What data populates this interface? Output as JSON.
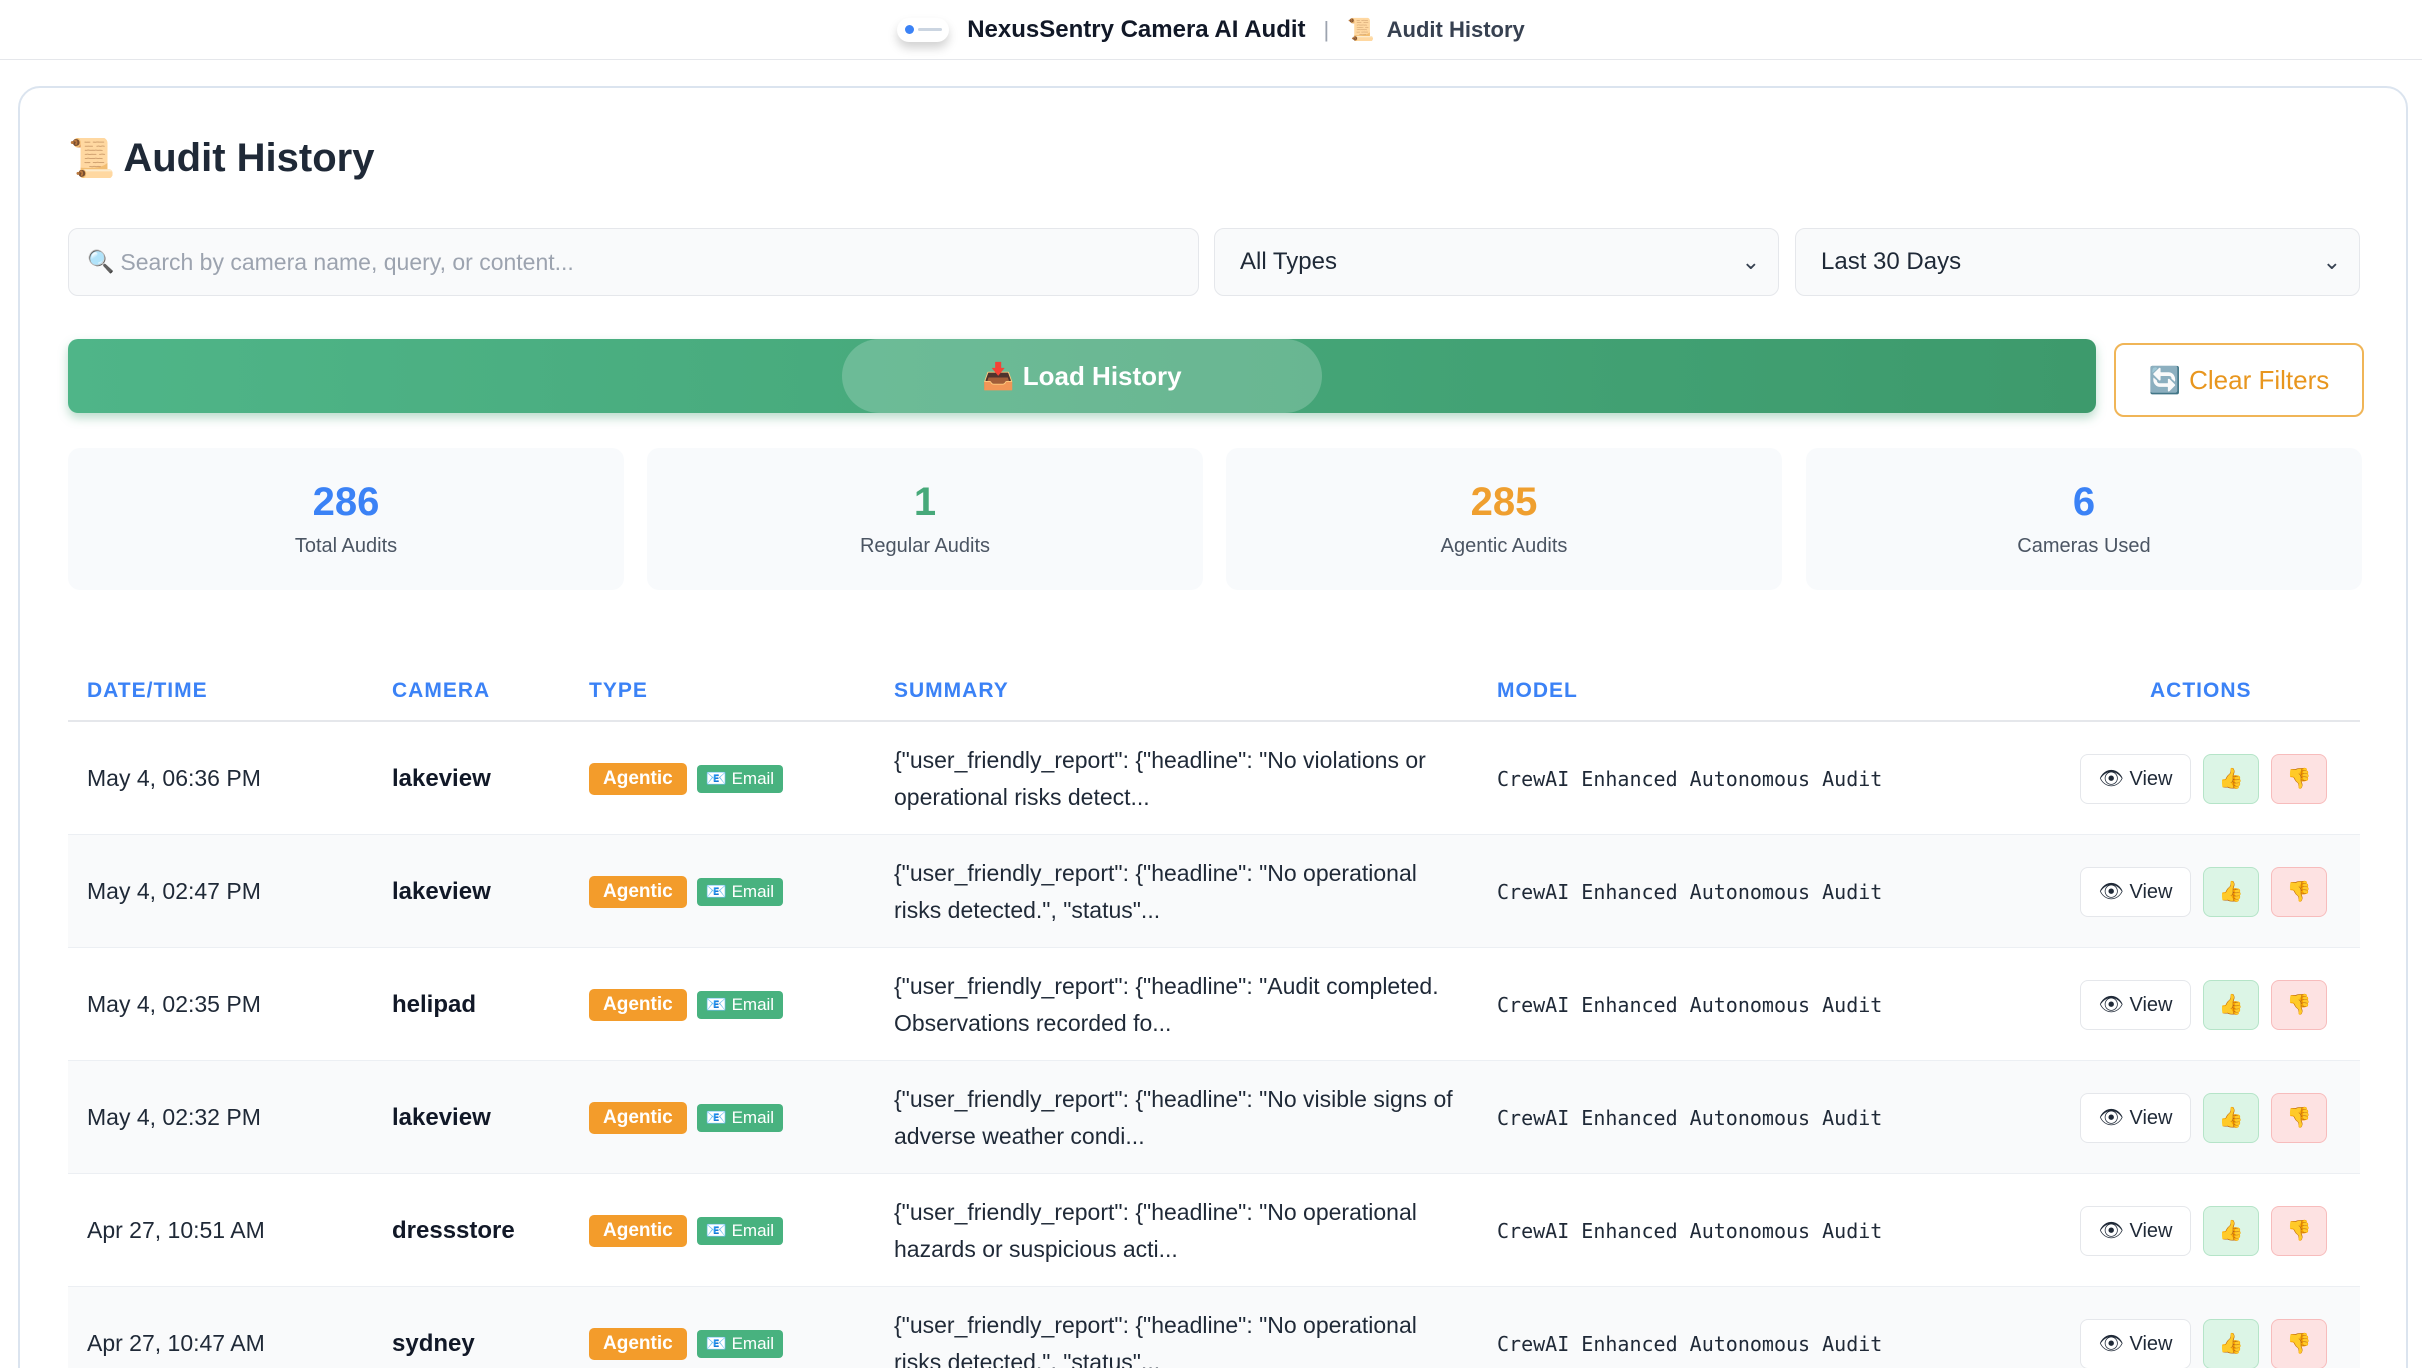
{
  "header": {
    "app_title": "NexusSentry Camera AI Audit",
    "separator": "|",
    "breadcrumb_icon": "📜",
    "breadcrumb": "Audit History"
  },
  "page": {
    "title_icon": "📜",
    "title": "Audit History"
  },
  "filters": {
    "search_icon": "🔍",
    "search_placeholder": "Search by camera name, query, or content...",
    "type_selected": "All Types",
    "range_selected": "Last 30 Days"
  },
  "buttons": {
    "load_icon": "📥",
    "load_label": "Load History",
    "clear_icon": "🔄",
    "clear_label": "Clear Filters"
  },
  "stats": [
    {
      "value": "286",
      "label": "Total Audits"
    },
    {
      "value": "1",
      "label": "Regular Audits"
    },
    {
      "value": "285",
      "label": "Agentic Audits"
    },
    {
      "value": "6",
      "label": "Cameras Used"
    }
  ],
  "table": {
    "headers": [
      "DATE/TIME",
      "CAMERA",
      "TYPE",
      "SUMMARY",
      "MODEL",
      "ACTIONS"
    ],
    "rows": [
      {
        "date": "May 4, 06:36 PM",
        "camera": "lakeview",
        "type": "Agentic",
        "channel": "📧 Email",
        "summary": "{\"user_friendly_report\": {\"headline\": \"No violations or operational risks detect...",
        "model": "CrewAI Enhanced Autonomous Audit",
        "view": "👁 View",
        "up": "👍",
        "down": "👎"
      },
      {
        "date": "May 4, 02:47 PM",
        "camera": "lakeview",
        "type": "Agentic",
        "channel": "📧 Email",
        "summary": "{\"user_friendly_report\": {\"headline\": \"No operational risks detected.\", \"status\"...",
        "model": "CrewAI Enhanced Autonomous Audit",
        "view": "👁 View",
        "up": "👍",
        "down": "👎"
      },
      {
        "date": "May 4, 02:35 PM",
        "camera": "helipad",
        "type": "Agentic",
        "channel": "📧 Email",
        "summary": "{\"user_friendly_report\": {\"headline\": \"Audit completed. Observations recorded fo...",
        "model": "CrewAI Enhanced Autonomous Audit",
        "view": "👁 View",
        "up": "👍",
        "down": "👎"
      },
      {
        "date": "May 4, 02:32 PM",
        "camera": "lakeview",
        "type": "Agentic",
        "channel": "📧 Email",
        "summary": "{\"user_friendly_report\": {\"headline\": \"No visible signs of adverse weather condi...",
        "model": "CrewAI Enhanced Autonomous Audit",
        "view": "👁 View",
        "up": "👍",
        "down": "👎"
      },
      {
        "date": "Apr 27, 10:51 AM",
        "camera": "dressstore",
        "type": "Agentic",
        "channel": "📧 Email",
        "summary": "{\"user_friendly_report\": {\"headline\": \"No operational hazards or suspicious acti...",
        "model": "CrewAI Enhanced Autonomous Audit",
        "view": "👁 View",
        "up": "👍",
        "down": "👎"
      },
      {
        "date": "Apr 27, 10:47 AM",
        "camera": "sydney",
        "type": "Agentic",
        "channel": "📧 Email",
        "summary": "{\"user_friendly_report\": {\"headline\": \"No operational risks detected.\", \"status\"...",
        "model": "CrewAI Enhanced Autonomous Audit",
        "view": "👁 View",
        "up": "👍",
        "down": "👎"
      }
    ]
  }
}
